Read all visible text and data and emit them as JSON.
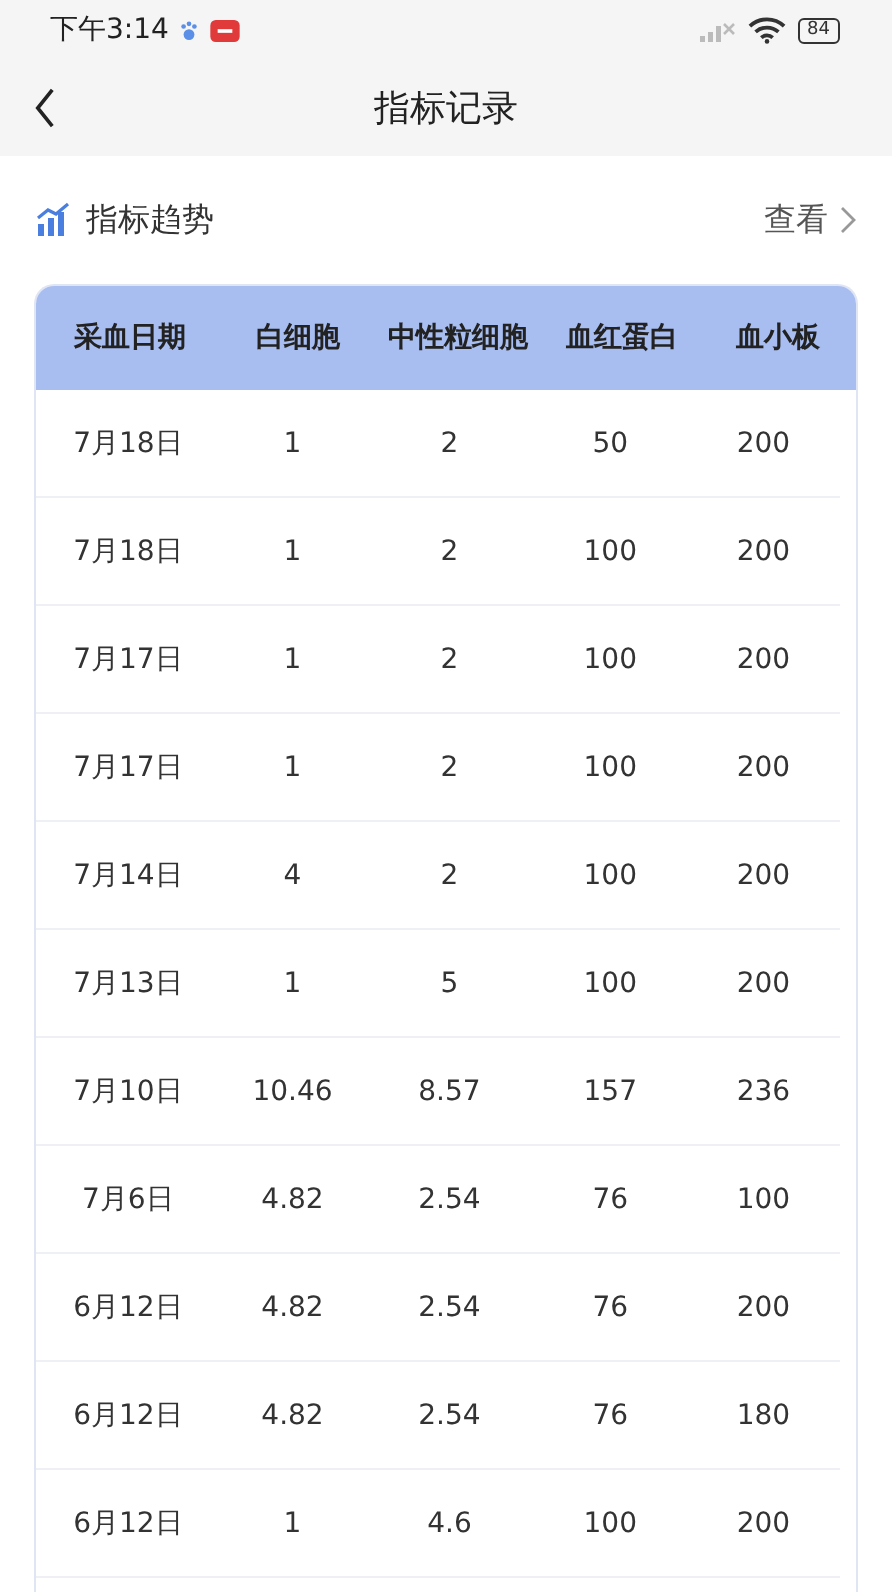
{
  "status_bar": {
    "time": "下午3:14",
    "battery": "84"
  },
  "header": {
    "title": "指标记录"
  },
  "section": {
    "title": "指标趋势",
    "action": "查看"
  },
  "table": {
    "columns": [
      "采血日期",
      "白细胞",
      "中性粒细胞",
      "血红蛋白",
      "血小板"
    ],
    "rows": [
      [
        "7月18日",
        "1",
        "2",
        "50",
        "200"
      ],
      [
        "7月18日",
        "1",
        "2",
        "100",
        "200"
      ],
      [
        "7月17日",
        "1",
        "2",
        "100",
        "200"
      ],
      [
        "7月17日",
        "1",
        "2",
        "100",
        "200"
      ],
      [
        "7月14日",
        "4",
        "2",
        "100",
        "200"
      ],
      [
        "7月13日",
        "1",
        "5",
        "100",
        "200"
      ],
      [
        "7月10日",
        "10.46",
        "8.57",
        "157",
        "236"
      ],
      [
        "7月6日",
        "4.82",
        "2.54",
        "76",
        "100"
      ],
      [
        "6月12日",
        "4.82",
        "2.54",
        "76",
        "200"
      ],
      [
        "6月12日",
        "4.82",
        "2.54",
        "76",
        "180"
      ],
      [
        "6月12日",
        "1",
        "4.6",
        "100",
        "200"
      ]
    ]
  }
}
